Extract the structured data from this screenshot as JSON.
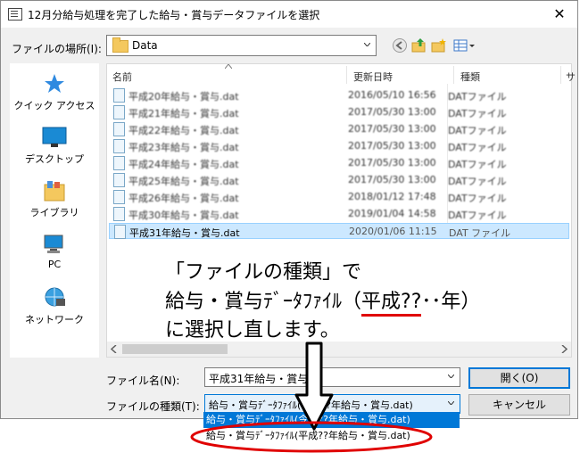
{
  "window": {
    "title": "12月分給与処理を完了した給与・賞与データファイルを選択",
    "close_symbol": "✕"
  },
  "location": {
    "label": "ファイルの場所(I):",
    "folder": "Data"
  },
  "sidebar": {
    "items": [
      {
        "label": "クイック アクセス"
      },
      {
        "label": "デスクトップ"
      },
      {
        "label": "ライブラリ"
      },
      {
        "label": "PC"
      },
      {
        "label": "ネットワーク"
      }
    ]
  },
  "columns": {
    "name": "名前",
    "modified": "更新日時",
    "type": "種類",
    "size": "サ"
  },
  "files": [
    {
      "name": "平成20年給与・賞与.dat",
      "date": "2016/05/10 16:56",
      "type": "DATファイル"
    },
    {
      "name": "平成21年給与・賞与.dat",
      "date": "2017/05/30 13:00",
      "type": "DATファイル"
    },
    {
      "name": "平成22年給与・賞与.dat",
      "date": "2017/05/30 13:00",
      "type": "DATファイル"
    },
    {
      "name": "平成23年給与・賞与.dat",
      "date": "2017/05/30 13:00",
      "type": "DATファイル"
    },
    {
      "name": "平成24年給与・賞与.dat",
      "date": "2017/05/30 13:00",
      "type": "DATファイル"
    },
    {
      "name": "平成25年給与・賞与.dat",
      "date": "2017/05/30 13:00",
      "type": "DATファイル"
    },
    {
      "name": "平成26年給与・賞与.dat",
      "date": "2018/01/12 17:48",
      "type": "DATファイル"
    },
    {
      "name": "平成30年給与・賞与.dat",
      "date": "2019/01/04 14:58",
      "type": "DATファイル"
    },
    {
      "name": "平成31年給与・賞与.dat",
      "date": "2020/01/06 11:15",
      "type": "DAT ファイル"
    }
  ],
  "annotation": {
    "line1": "「ファイルの種類」で",
    "line2a": "給与・賞与ﾃﾞｰﾀﾌｧｲﾙ（",
    "line2b": "平成??",
    "line2c": "･･年）",
    "line3": "に選択し直します。"
  },
  "filename": {
    "label": "ファイル名(N):",
    "value": "平成31年給与・賞与"
  },
  "filetype": {
    "label": "ファイルの種類(T):",
    "value": "給与・賞与ﾃﾞｰﾀﾌｧｲﾙ(平成??年給与・賞与.dat)",
    "options": [
      "給与・賞与ﾃﾞｰﾀﾌｧｲﾙ(令和??年給与・賞与.dat)",
      "給与・賞与ﾃﾞｰﾀﾌｧｲﾙ(平成??年給与・賞与.dat)"
    ]
  },
  "buttons": {
    "open": "開く(O)",
    "cancel": "キャンセル"
  },
  "colors": {
    "accent": "#0078d7",
    "highlight": "#e00000",
    "selection": "#cce8ff"
  }
}
